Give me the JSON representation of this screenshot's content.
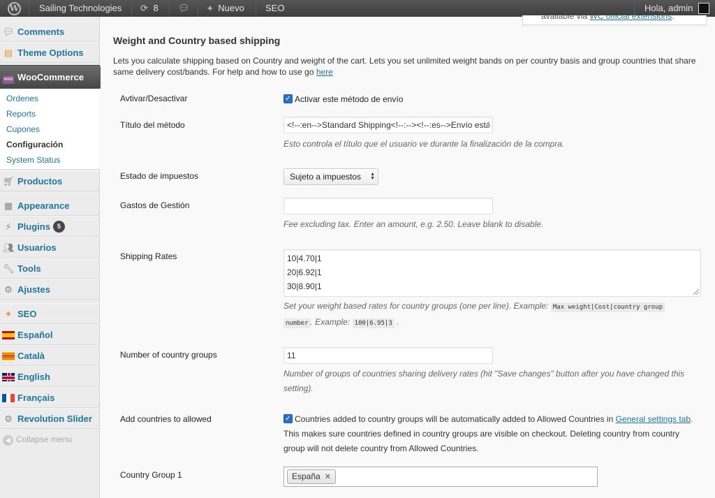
{
  "admin_bar": {
    "site_name": "Sailing Technologies",
    "updates_count": "8",
    "new_label": "Nuevo",
    "seo_label": "SEO",
    "greeting": "Hola, admin"
  },
  "sidebar": {
    "items": [
      {
        "label": "Comments",
        "icon": "comments-icon"
      },
      {
        "label": "Theme Options",
        "icon": "theme-options-icon"
      },
      {
        "label": "WooCommerce",
        "icon": "woocommerce-icon"
      },
      {
        "label": "Productos",
        "icon": "products-icon"
      },
      {
        "label": "Appearance",
        "icon": "appearance-icon"
      },
      {
        "label": "Plugins",
        "icon": "plugins-icon",
        "badge": "5"
      },
      {
        "label": "Usuarios",
        "icon": "users-icon"
      },
      {
        "label": "Tools",
        "icon": "tools-icon"
      },
      {
        "label": "Ajustes",
        "icon": "settings-icon"
      },
      {
        "label": "SEO",
        "icon": "seo-icon"
      },
      {
        "label": "Español",
        "icon": "flag-es-icon"
      },
      {
        "label": "Català",
        "icon": "flag-ca-icon"
      },
      {
        "label": "English",
        "icon": "flag-en-icon"
      },
      {
        "label": "Français",
        "icon": "flag-fr-icon"
      },
      {
        "label": "Revolution Slider",
        "icon": "revolution-slider-icon"
      }
    ],
    "submenu": [
      "Ordenes",
      "Reports",
      "Cupones",
      "Configuración",
      "System Status"
    ],
    "collapse_label": "Collapse menu"
  },
  "notice": {
    "prefix": "available via ",
    "link": "WC official extensions",
    "suffix": "."
  },
  "section": {
    "title": "Weight and Country based shipping",
    "description": "Lets you calculate shipping based on Country and weight of the cart. Lets you set unlimited weight bands on per country basis and group countries that share same delivery cost/bands. For help and how to use go ",
    "help_link": "here"
  },
  "fields": {
    "enable": {
      "label": "Avtivar/Desactivar",
      "checkbox_label": "Activar este método de envío"
    },
    "title": {
      "label": "Título del método",
      "value": "<!--:en-->Standard Shipping<!--:--><!--:es-->Envío está",
      "hint": "Esto controla el título que el usuario ve durante la finalización de la compra."
    },
    "tax_status": {
      "label": "Estado de impuestos",
      "value": "Sujeto a impuestos"
    },
    "handling_fee": {
      "label": "Gastos de Gestión",
      "value": "",
      "hint": "Fee excluding tax. Enter an amount, e.g. 2.50. Leave blank to disable."
    },
    "shipping_rates": {
      "label": "Shipping Rates",
      "lines": [
        "10|4.70|1",
        "20|6.92|1",
        "30|8.90|1"
      ],
      "hint_prefix": "Set your weight based rates for country groups (one per line). Example: ",
      "hint_code1a": "Max weight|Cost|country group",
      "hint_code1b": "number",
      "hint_mid": ". Example: ",
      "hint_code2": "100|6.95|3",
      "hint_suffix": " ."
    },
    "country_groups": {
      "label": "Number of country groups",
      "value": "11",
      "hint": "Number of groups of countries sharing delivery rates (hit \"Save changes\" button after you have changed this setting)."
    },
    "add_countries": {
      "label": "Add countries to allowed",
      "checkbox_label": "Countries added to country groups will be automatically added to Allowed Countries in ",
      "link": "General settings tab",
      "rest": ". This makes sure countries defined in country groups are visible on checkout. Deleting country from country group will not delete country from Allowed Countries."
    },
    "country_group_1": {
      "label": "Country Group 1",
      "tag": "España"
    }
  },
  "colors": {
    "link": "#21759b",
    "admin_bar": "#464646",
    "woo_purple": "#8c5c94"
  }
}
